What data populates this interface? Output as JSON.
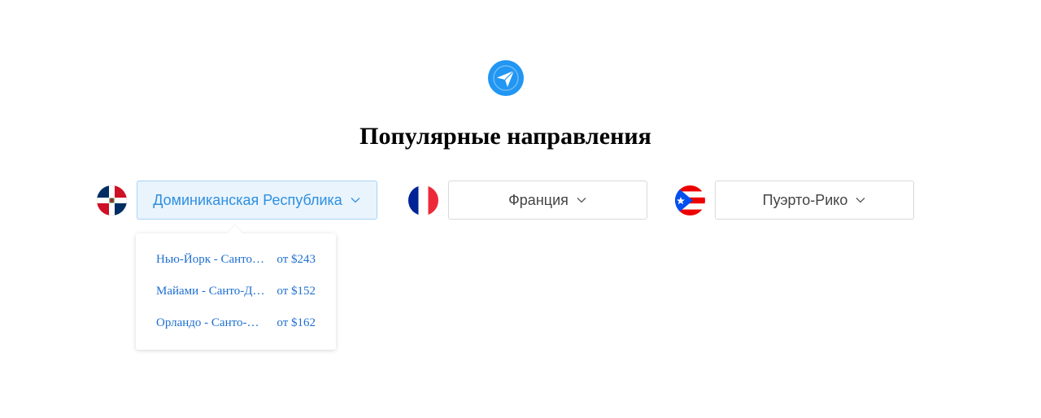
{
  "logo": {
    "icon": "paper-plane-icon",
    "color": "#2196f3"
  },
  "title": "Популярные направления",
  "destinations": [
    {
      "flag": "dominican-republic-flag-icon",
      "label": "Доминиканская Республика",
      "active": true
    },
    {
      "flag": "france-flag-icon",
      "label": "Франция",
      "active": false
    },
    {
      "flag": "puerto-rico-flag-icon",
      "label": "Пуэрто-Рико",
      "active": false
    }
  ],
  "menu": {
    "items": [
      {
        "route": "Нью-Йорк - Санто-Доминго",
        "price": "от $243"
      },
      {
        "route": "Майами - Санто-Доминго",
        "price": "от $152"
      },
      {
        "route": "Орландо - Санто-Доминго",
        "price": "от $162"
      }
    ]
  },
  "colors": {
    "accent": "#2e8fe0",
    "link": "#1e6fcf",
    "active_bg": "#eaf4fd"
  },
  "icons": {
    "chevron": "chevron-down-icon"
  }
}
